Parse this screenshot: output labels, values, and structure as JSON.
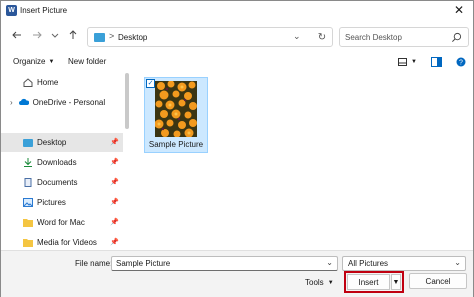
{
  "window": {
    "title": "Insert Picture",
    "app_icon": "word-icon",
    "app_icon_letter": "W"
  },
  "navigation": {
    "back": "back-arrow-icon",
    "forward": "forward-arrow-icon",
    "recent": "chevron-down-icon",
    "up": "up-arrow-icon"
  },
  "address_bar": {
    "path": "Desktop",
    "separator": ">"
  },
  "search": {
    "placeholder": "Search Desktop"
  },
  "toolbar": {
    "organize_label": "Organize",
    "new_folder_label": "New folder"
  },
  "sidebar": {
    "items": [
      {
        "label": "Home",
        "icon": "home-icon"
      },
      {
        "label": "OneDrive - Personal",
        "icon": "cloud-icon",
        "expandable": true
      },
      {
        "label": "Desktop",
        "icon": "desktop-folder-icon",
        "pinned": true,
        "selected": true
      },
      {
        "label": "Downloads",
        "icon": "download-icon",
        "pinned": true
      },
      {
        "label": "Documents",
        "icon": "document-icon",
        "pinned": true
      },
      {
        "label": "Pictures",
        "icon": "pictures-icon",
        "pinned": true
      },
      {
        "label": "Word for Mac",
        "icon": "folder-icon",
        "pinned": true
      },
      {
        "label": "Media for Videos",
        "icon": "folder-icon",
        "pinned": true
      }
    ]
  },
  "files": [
    {
      "name": "Sample Picture",
      "selected": true,
      "checked": true
    }
  ],
  "footer": {
    "file_name_label": "File name:",
    "file_name_value": "Sample Picture",
    "file_type": "All Pictures",
    "tools_label": "Tools",
    "insert_label": "Insert",
    "cancel_label": "Cancel"
  },
  "colors": {
    "selection_bg": "#cce8ff",
    "highlight_border": "#c00010",
    "folder": "#f4c542",
    "accent": "#0067c0"
  }
}
